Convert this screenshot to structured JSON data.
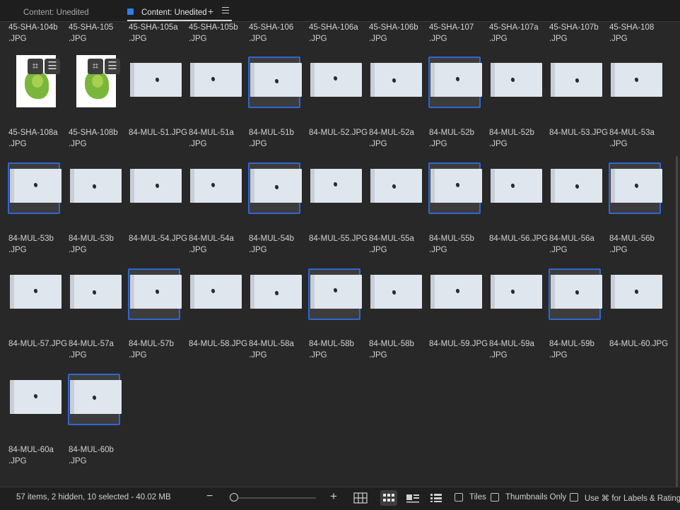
{
  "tabs": [
    {
      "label": "Content: Unedited"
    },
    {
      "label": "Content: Unedited"
    }
  ],
  "items": [
    {
      "l1": "45-SHA-104b",
      "l2": ".JPG",
      "sel": false,
      "kind": "partial"
    },
    {
      "l1": "45-SHA-105",
      "l2": ".JPG",
      "sel": false,
      "kind": "partial"
    },
    {
      "l1": "45-SHA-105a",
      "l2": ".JPG",
      "sel": false,
      "kind": "partial"
    },
    {
      "l1": "45-SHA-105b",
      "l2": ".JPG",
      "sel": false,
      "kind": "partial"
    },
    {
      "l1": "45-SHA-106",
      "l2": ".JPG",
      "sel": false,
      "kind": "partial"
    },
    {
      "l1": "45-SHA-106a",
      "l2": ".JPG",
      "sel": false,
      "kind": "partial"
    },
    {
      "l1": "45-SHA-106b",
      "l2": ".JPG",
      "sel": false,
      "kind": "partial"
    },
    {
      "l1": "45-SHA-107",
      "l2": ".JPG",
      "sel": false,
      "kind": "partial"
    },
    {
      "l1": "45-SHA-107a",
      "l2": ".JPG",
      "sel": false,
      "kind": "partial"
    },
    {
      "l1": "45-SHA-107b",
      "l2": ".JPG",
      "sel": false,
      "kind": "partial"
    },
    {
      "l1": "45-SHA-108",
      "l2": ".JPG",
      "sel": false,
      "kind": "partial"
    },
    {
      "l1": "45-SHA-108a",
      "l2": ".JPG",
      "sel": false,
      "kind": "green"
    },
    {
      "l1": "45-SHA-108b",
      "l2": ".JPG",
      "sel": false,
      "kind": "green"
    },
    {
      "l1": "84-MUL-51.JPG",
      "l2": "",
      "sel": false,
      "kind": "white"
    },
    {
      "l1": "84-MUL-51a",
      "l2": ".JPG",
      "sel": false,
      "kind": "white"
    },
    {
      "l1": "84-MUL-51b",
      "l2": ".JPG",
      "sel": true,
      "kind": "white"
    },
    {
      "l1": "84-MUL-52.JPG",
      "l2": "",
      "sel": false,
      "kind": "white"
    },
    {
      "l1": "84-MUL-52a",
      "l2": ".JPG",
      "sel": false,
      "kind": "white"
    },
    {
      "l1": "84-MUL-52b",
      "l2": ".JPG",
      "sel": true,
      "kind": "white"
    },
    {
      "l1": "84-MUL-52b",
      "l2": ".JPG",
      "sel": false,
      "kind": "white"
    },
    {
      "l1": "84-MUL-53.JPG",
      "l2": "",
      "sel": false,
      "kind": "white"
    },
    {
      "l1": "84-MUL-53a",
      "l2": ".JPG",
      "sel": false,
      "kind": "white"
    },
    {
      "l1": "84-MUL-53b",
      "l2": ".JPG",
      "sel": true,
      "kind": "white"
    },
    {
      "l1": "84-MUL-53b",
      "l2": ".JPG",
      "sel": false,
      "kind": "white"
    },
    {
      "l1": "84-MUL-54.JPG",
      "l2": "",
      "sel": false,
      "kind": "white"
    },
    {
      "l1": "84-MUL-54a",
      "l2": ".JPG",
      "sel": false,
      "kind": "white"
    },
    {
      "l1": "84-MUL-54b",
      "l2": ".JPG",
      "sel": true,
      "kind": "white"
    },
    {
      "l1": "84-MUL-55.JPG",
      "l2": "",
      "sel": false,
      "kind": "white"
    },
    {
      "l1": "84-MUL-55a",
      "l2": ".JPG",
      "sel": false,
      "kind": "white"
    },
    {
      "l1": "84-MUL-55b",
      "l2": ".JPG",
      "sel": true,
      "kind": "white"
    },
    {
      "l1": "84-MUL-56.JPG",
      "l2": "",
      "sel": false,
      "kind": "white"
    },
    {
      "l1": "84-MUL-56a",
      "l2": ".JPG",
      "sel": false,
      "kind": "white"
    },
    {
      "l1": "84-MUL-56b",
      "l2": ".JPG",
      "sel": true,
      "kind": "white"
    },
    {
      "l1": "84-MUL-57.JPG",
      "l2": "",
      "sel": false,
      "kind": "white"
    },
    {
      "l1": "84-MUL-57a",
      "l2": ".JPG",
      "sel": false,
      "kind": "white"
    },
    {
      "l1": "84-MUL-57b",
      "l2": ".JPG",
      "sel": true,
      "kind": "white"
    },
    {
      "l1": "84-MUL-58.JPG",
      "l2": "",
      "sel": false,
      "kind": "white"
    },
    {
      "l1": "84-MUL-58a",
      "l2": ".JPG",
      "sel": false,
      "kind": "white"
    },
    {
      "l1": "84-MUL-58b",
      "l2": ".JPG",
      "sel": true,
      "kind": "white"
    },
    {
      "l1": "84-MUL-58b",
      "l2": ".JPG",
      "sel": false,
      "kind": "white"
    },
    {
      "l1": "84-MUL-59.JPG",
      "l2": "",
      "sel": false,
      "kind": "white"
    },
    {
      "l1": "84-MUL-59a",
      "l2": ".JPG",
      "sel": false,
      "kind": "white"
    },
    {
      "l1": "84-MUL-59b",
      "l2": ".JPG",
      "sel": true,
      "kind": "white"
    },
    {
      "l1": "84-MUL-60.JPG",
      "l2": "",
      "sel": false,
      "kind": "white"
    },
    {
      "l1": "84-MUL-60a",
      "l2": ".JPG",
      "sel": false,
      "kind": "white"
    },
    {
      "l1": "84-MUL-60b",
      "l2": ".JPG",
      "sel": true,
      "kind": "white"
    }
  ],
  "status": {
    "summary": "57 items, 2 hidden, 10 selected - 40.02 MB",
    "zoom_minus": "−",
    "zoom_plus": "+",
    "zoom_level": 0.0,
    "view_modes": [
      {
        "icon": "thumbnail-grid-icon"
      },
      {
        "icon": "grid-view-icon",
        "active": true
      },
      {
        "icon": "filmstrip-view-icon"
      },
      {
        "icon": "list-view-icon"
      }
    ],
    "tiles_label": "Tiles",
    "thumbs_only_label": "Thumbnails Only",
    "labels_label": "Use ⌘ for Labels & Ratings"
  },
  "colors": {
    "selection": "#2f67d3",
    "accent": "#2f7df6",
    "background": "#282828"
  }
}
